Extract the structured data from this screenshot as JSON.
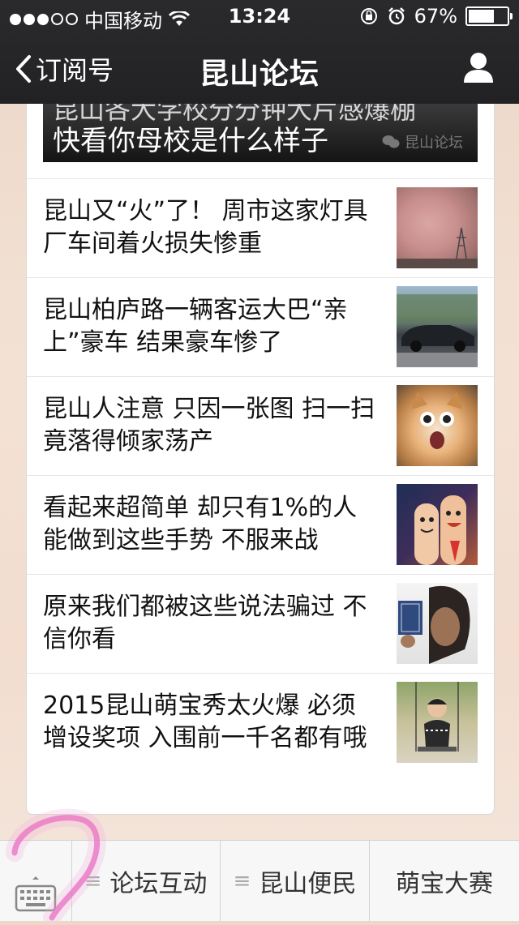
{
  "status_bar": {
    "carrier": "中国移动",
    "time": "13:24",
    "battery": "67%",
    "battery_level": 0.67
  },
  "nav": {
    "back_label": "订阅号",
    "title": "昆山论坛"
  },
  "banner": {
    "headline_partial": "昆山各大学校分分钟大片感爆棚",
    "headline": "快看你母校是什么样子",
    "watermark": "昆山论坛"
  },
  "articles": [
    {
      "title": "昆山又“火”了！ 周市这家灯具厂车间着火损失惨重"
    },
    {
      "title": "昆山柏庐路一辆客运大巴“亲上”豪车 结果豪车惨了"
    },
    {
      "title": "昆山人注意 只因一张图 扫一扫竟落得倾家荡产"
    },
    {
      "title": "看起来超简单 却只有1%的人能做到这些手势 不服来战"
    },
    {
      "title": "原来我们都被这些说法骗过 不信你看"
    },
    {
      "title": "2015昆山萌宝秀太火爆 必须增设奖项 入围前一千名都有哦"
    }
  ],
  "bottom_menu": {
    "tab1": "论坛互动",
    "tab2": "昆山便民",
    "tab3": "萌宝大赛"
  },
  "colors": {
    "topbar": "#222224",
    "annotation": "#e86fc2"
  }
}
